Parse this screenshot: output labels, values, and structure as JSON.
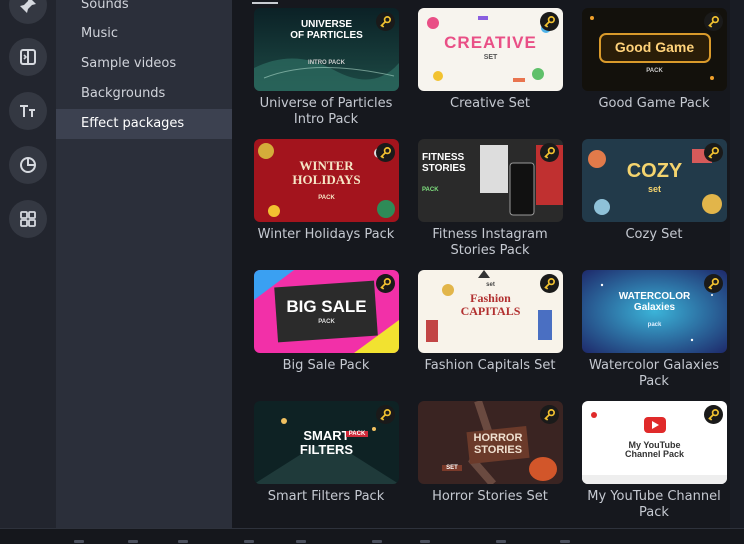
{
  "sidebar": {
    "categories": [
      {
        "label": "Sounds",
        "active": false
      },
      {
        "label": "Music",
        "active": false
      },
      {
        "label": "Sample videos",
        "active": false
      },
      {
        "label": "Backgrounds",
        "active": false
      },
      {
        "label": "Effect packages",
        "active": true
      }
    ],
    "rail_icons": [
      "pin-icon",
      "transition-icon",
      "titles-icon",
      "stickers-icon",
      "more-tools-icon"
    ]
  },
  "packages": [
    {
      "caption": "Universe of Particles\nIntro Pack",
      "thumb_text": "UNIVERSE\nOF PARTICLES",
      "thumb_sub": "INTRO PACK",
      "premium": true
    },
    {
      "caption": "Creative Set",
      "thumb_text": "CREATIVE",
      "thumb_sub": "SET",
      "premium": true
    },
    {
      "caption": "Good Game Pack",
      "thumb_text": "Good Game",
      "thumb_sub": "PACK",
      "premium": true
    },
    {
      "caption": "Winter Holidays Pack",
      "thumb_text": "WINTER\nHOLIDAYS",
      "thumb_sub": "PACK",
      "premium": true
    },
    {
      "caption": "Fitness Instagram\nStories Pack",
      "thumb_text": "FITNESS\nSTORIES",
      "thumb_sub": "PACK",
      "premium": true
    },
    {
      "caption": "Cozy Set",
      "thumb_text": "COZY",
      "thumb_sub": "set",
      "premium": true
    },
    {
      "caption": "Big Sale Pack",
      "thumb_text": "BIG SALE",
      "thumb_sub": "PACK",
      "premium": true
    },
    {
      "caption": "Fashion Capitals Set",
      "thumb_text": "Fashion\nCAPITALS",
      "thumb_sub": "set",
      "premium": true
    },
    {
      "caption": "Watercolor Galaxies\nPack",
      "thumb_text": "WATERCOLOR\nGalaxies",
      "thumb_sub": "pack",
      "premium": true
    },
    {
      "caption": "Smart Filters Pack",
      "thumb_text": "SMART\nFILTERS",
      "thumb_sub": "PACK",
      "premium": true
    },
    {
      "caption": "Horror Stories Set",
      "thumb_text": "HORROR\nSTORIES",
      "thumb_sub": "SET",
      "premium": true
    },
    {
      "caption": "My YouTube Channel\nPack",
      "thumb_text": "My YouTube\nChannel Pack",
      "thumb_sub": "",
      "premium": true
    }
  ],
  "colors": {
    "rail_bg": "#22252e",
    "panel_bg": "#2b2f3a",
    "active_bg": "#3c4150",
    "main_bg": "#16181e",
    "key_badge": "#f2c230"
  }
}
